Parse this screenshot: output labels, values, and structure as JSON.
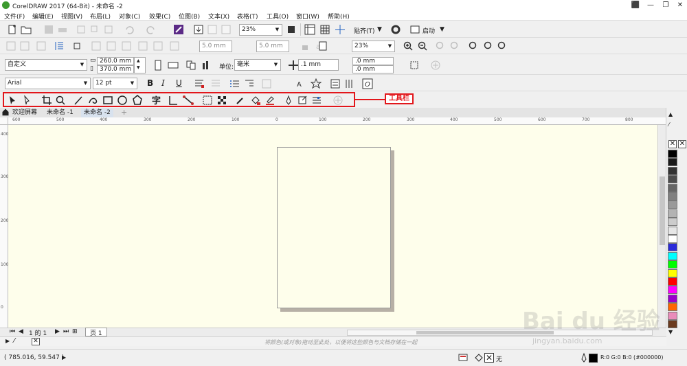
{
  "window": {
    "title": "CorelDRAW 2017 (64-Bit) - 未命名 -2"
  },
  "menus": [
    "文件(F)",
    "编辑(E)",
    "视图(V)",
    "布局(L)",
    "对象(C)",
    "效果(C)",
    "位图(B)",
    "文本(X)",
    "表格(T)",
    "工具(O)",
    "窗口(W)",
    "帮助(H)"
  ],
  "standard_toolbar": {
    "zoom": "23%",
    "snap_label": "贴齐(T)",
    "launch_label": "启动"
  },
  "toolbar2": {
    "nudge1": "5.0 mm",
    "nudge2": "5.0 mm",
    "zoom": "23%"
  },
  "property_bar": {
    "page_preset": "自定义",
    "width": "260.0 mm",
    "height": "370.0 mm",
    "unit_label": "单位:",
    "unit": "毫米",
    "nudge": ".1 mm",
    "dup_x": ".0 mm",
    "dup_y": ".0 mm"
  },
  "text_bar": {
    "font": "Arial",
    "size": "12 pt"
  },
  "annotation": {
    "label": "工具栏",
    "color": "#e2161b"
  },
  "doc_tabs": [
    {
      "label": "欢迎屏幕"
    },
    {
      "label": "未命名 -1"
    },
    {
      "label": "未命名 -2"
    }
  ],
  "ruler_h": [
    "600",
    "500",
    "400",
    "300",
    "200",
    "100",
    "0",
    "100",
    "200",
    "300",
    "400",
    "500",
    "600",
    "700",
    "800"
  ],
  "ruler_v": [
    "400",
    "300",
    "200",
    "100",
    "0"
  ],
  "page_nav": {
    "pos": "1 的 1",
    "page_tab": "页 1"
  },
  "hint": "将颜色(或对象)拖动至此处，以便将这些颜色与文档存储在一起",
  "status": {
    "coords": "( 785.016, 59.547 )",
    "fill_none": "无",
    "outline_info": "R:0 G:0 B:0 (#000000)"
  },
  "palette": [
    "#000000",
    "#1a1a1a",
    "#333333",
    "#4d4d4d",
    "#666666",
    "#808080",
    "#999999",
    "#b3b3b3",
    "#cccccc",
    "#e6e6e6",
    "#ffffff",
    "#2b2bd9",
    "#00ffff",
    "#00ff00",
    "#ffff00",
    "#ff0000",
    "#ff00ff",
    "#9900cc",
    "#ff6600",
    "#e98cba",
    "#6b3b1f"
  ],
  "watermark": {
    "brand": "Bai du 经验",
    "url": "jingyan.baidu.com"
  }
}
